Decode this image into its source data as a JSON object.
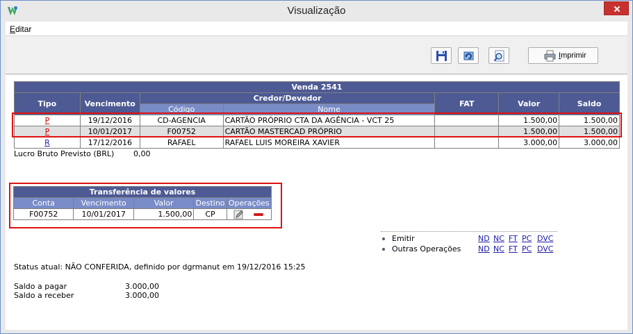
{
  "window": {
    "title": "Visualização"
  },
  "menu": {
    "items": [
      {
        "first": "E",
        "rest": "ditar"
      }
    ]
  },
  "toolbar": {
    "buttons": [
      {
        "icon": "save-icon"
      },
      {
        "icon": "refresh-icon"
      },
      {
        "icon": "preview-icon"
      }
    ],
    "print_first": "I",
    "print_rest": "mprimir"
  },
  "venda": {
    "title": "Venda  2541",
    "headers": {
      "tipo": "Tipo",
      "vencimento": "Vencimento",
      "credor": "Credor/Devedor",
      "codigo": "Código",
      "nome": "Nome",
      "fat": "FAT",
      "valor": "Valor",
      "saldo": "Saldo"
    },
    "rows": [
      {
        "tipo": "P",
        "vencimento": "19/12/2016",
        "codigo": "CD-AGENCIA",
        "nome": "CARTÃO PRÓPRIO CTA DA AGÊNCIA - VCT 25",
        "fat": "",
        "valor": "1.500,00",
        "saldo": "1.500,00"
      },
      {
        "tipo": "P",
        "vencimento": "10/01/2017",
        "codigo": "F00752",
        "nome": "CARTÃO MASTERCAD PRÓPRIO",
        "fat": "",
        "valor": "1.500,00",
        "saldo": "1.500,00"
      },
      {
        "tipo": "R",
        "vencimento": "17/12/2016",
        "codigo": "RAFAEL",
        "nome": "RAFAEL LUIS MOREIRA XAVIER",
        "fat": "",
        "valor": "3.000,00",
        "saldo": "3.000,00"
      }
    ],
    "lucro_label": "Lucro Bruto Previsto (BRL)",
    "lucro_value": "0,00"
  },
  "transfer": {
    "title": "Transferência de valores",
    "headers": {
      "conta": "Conta",
      "vencimento": "Vencimento",
      "valor": "Valor",
      "destino": "Destino",
      "operacoes": "Operações"
    },
    "row": {
      "conta": "F00752",
      "vencimento": "10/01/2017",
      "valor": "1.500,00",
      "destino": "CP"
    }
  },
  "operations": {
    "emitir_label": "Emitir",
    "outras_label": "Outras Operações",
    "links": [
      "ND",
      "NC",
      "FT",
      "PC",
      "DVC"
    ]
  },
  "status": {
    "text": "Status atual: NÃO CONFERIDA, definido por dgrmanut em 19/12/2016 15:25"
  },
  "saldos": {
    "pagar_label": "Saldo a pagar",
    "pagar_value": "3.000,00",
    "receber_label": "Saldo a receber",
    "receber_value": "3.000,00"
  },
  "colors": {
    "header_dark": "#4d5a94",
    "header_light": "#7a8cc8",
    "highlight_red": "#e01010",
    "close_red": "#c7312e"
  }
}
